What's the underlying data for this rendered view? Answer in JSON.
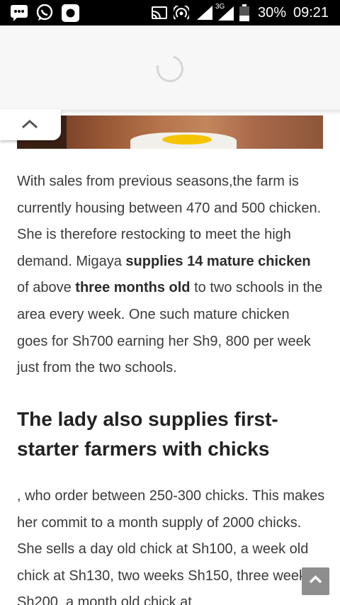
{
  "status_bar": {
    "icons": [
      "messaging-icon",
      "whatsapp-icon",
      "camera-app-icon",
      "cast-icon",
      "hotspot-icon",
      "signal-icon",
      "signal-3g-icon",
      "battery-icon"
    ],
    "network_label": "3G",
    "battery": "30%",
    "time": "09:21"
  },
  "colors": {
    "status_bar_bg": "#000000",
    "text": "#3b3b3b",
    "heading": "#222222",
    "back_to_top": "#8e8e8e"
  },
  "article": {
    "para1": {
      "t1": "With sales from previous seasons,the farm is currently housing between 470 and 500 chicken. She is therefore restocking to meet the high demand. Migaya ",
      "b1": "supplies 14 mature chicken",
      "t2": " of above ",
      "b2": "three months old",
      "t3": " to two schools in the area every week. One such mature chicken goes for Sh700 earning her Sh9, 800 per week just from the two schools."
    },
    "heading": "The lady also supplies first-starter farmers with chicks",
    "para2": ", who order between 250-300 chicks. This makes her commit to a month supply of 2000 chicks. She sells a day old chick at Sh100, a week old chick at Sh130, two weeks Sh150, three weeks Sh200, a month old chick at"
  }
}
